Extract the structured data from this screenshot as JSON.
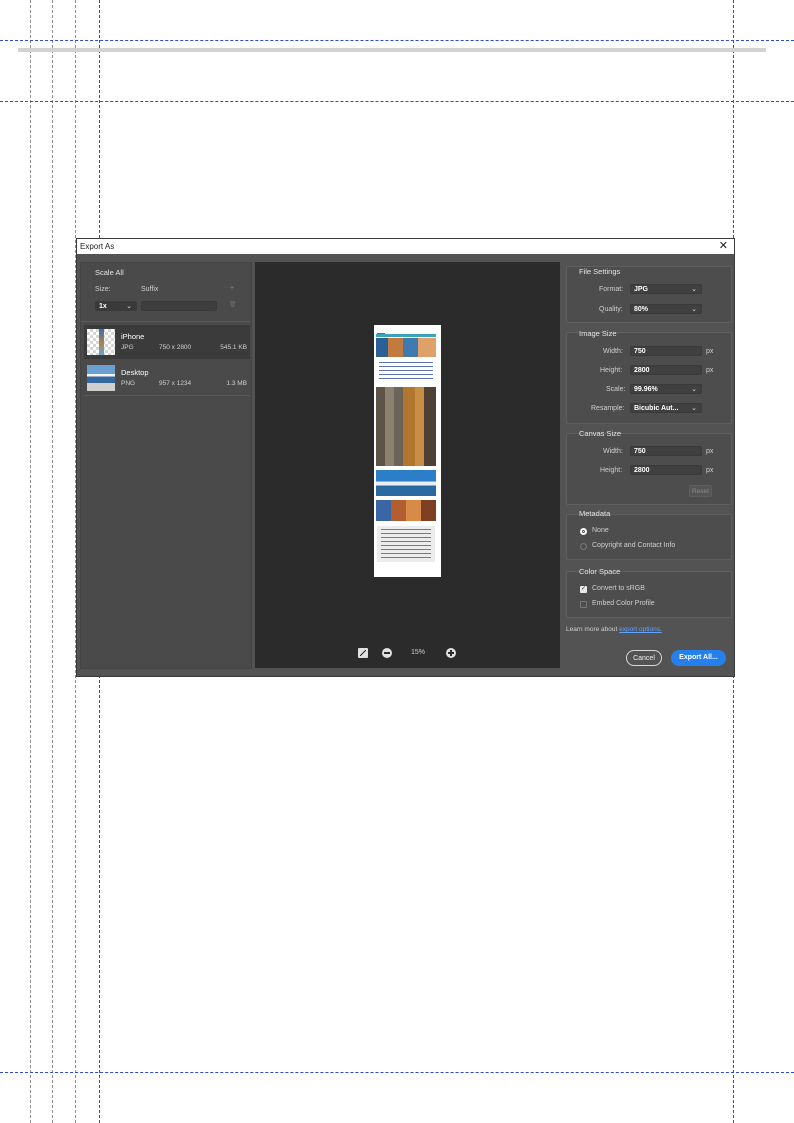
{
  "dialog": {
    "title": "Export As",
    "close_glyph": "✕"
  },
  "left_panel": {
    "scale_all_title": "Scale All",
    "size_label": "Size:",
    "suffix_label": "Suffix",
    "add_glyph": "+",
    "delete_glyph": "🗑",
    "scale_value": "1x",
    "suffix_value": "",
    "assets": [
      {
        "name": "iPhone",
        "format": "JPG",
        "dimensions": "750 x 2800",
        "file_size": "545.1 KB"
      },
      {
        "name": "Desktop",
        "format": "PNG",
        "dimensions": "957 x 1234",
        "file_size": "1.3 MB"
      }
    ]
  },
  "preview": {
    "zoom_level": "15%"
  },
  "file_settings": {
    "title": "File Settings",
    "format_label": "Format:",
    "format_value": "JPG",
    "quality_label": "Quality:",
    "quality_value": "80%"
  },
  "image_size": {
    "title": "Image Size",
    "width_label": "Width:",
    "width_value": "750",
    "height_label": "Height:",
    "height_value": "2800",
    "scale_label": "Scale:",
    "scale_value": "99.96%",
    "resample_label": "Resample:",
    "resample_value": "Bicubic Aut...",
    "unit": "px"
  },
  "canvas_size": {
    "title": "Canvas Size",
    "width_label": "Width:",
    "width_value": "750",
    "height_label": "Height:",
    "height_value": "2800",
    "unit": "px",
    "reset_label": "Reset"
  },
  "metadata": {
    "title": "Metadata",
    "options": [
      "None",
      "Copyright and Contact Info"
    ],
    "selected": "None"
  },
  "color_space": {
    "title": "Color Space",
    "convert_label": "Convert to sRGB",
    "convert_checked": true,
    "embed_label": "Embed Color Profile",
    "embed_checked": false
  },
  "footer": {
    "learn_more_text": "Learn more about",
    "learn_more_link": "export options.",
    "cancel_label": "Cancel",
    "export_label": "Export All..."
  },
  "colors": {
    "dialog_bg": "#535353",
    "preview_bg": "#2b2b2b",
    "primary_button": "#2680eb",
    "guide_blue": "#2b4bd8"
  },
  "icons": {
    "preview_toggle": "toggle-preview-icon",
    "zoom_out": "zoom-out-icon",
    "zoom_in": "zoom-in-icon"
  }
}
